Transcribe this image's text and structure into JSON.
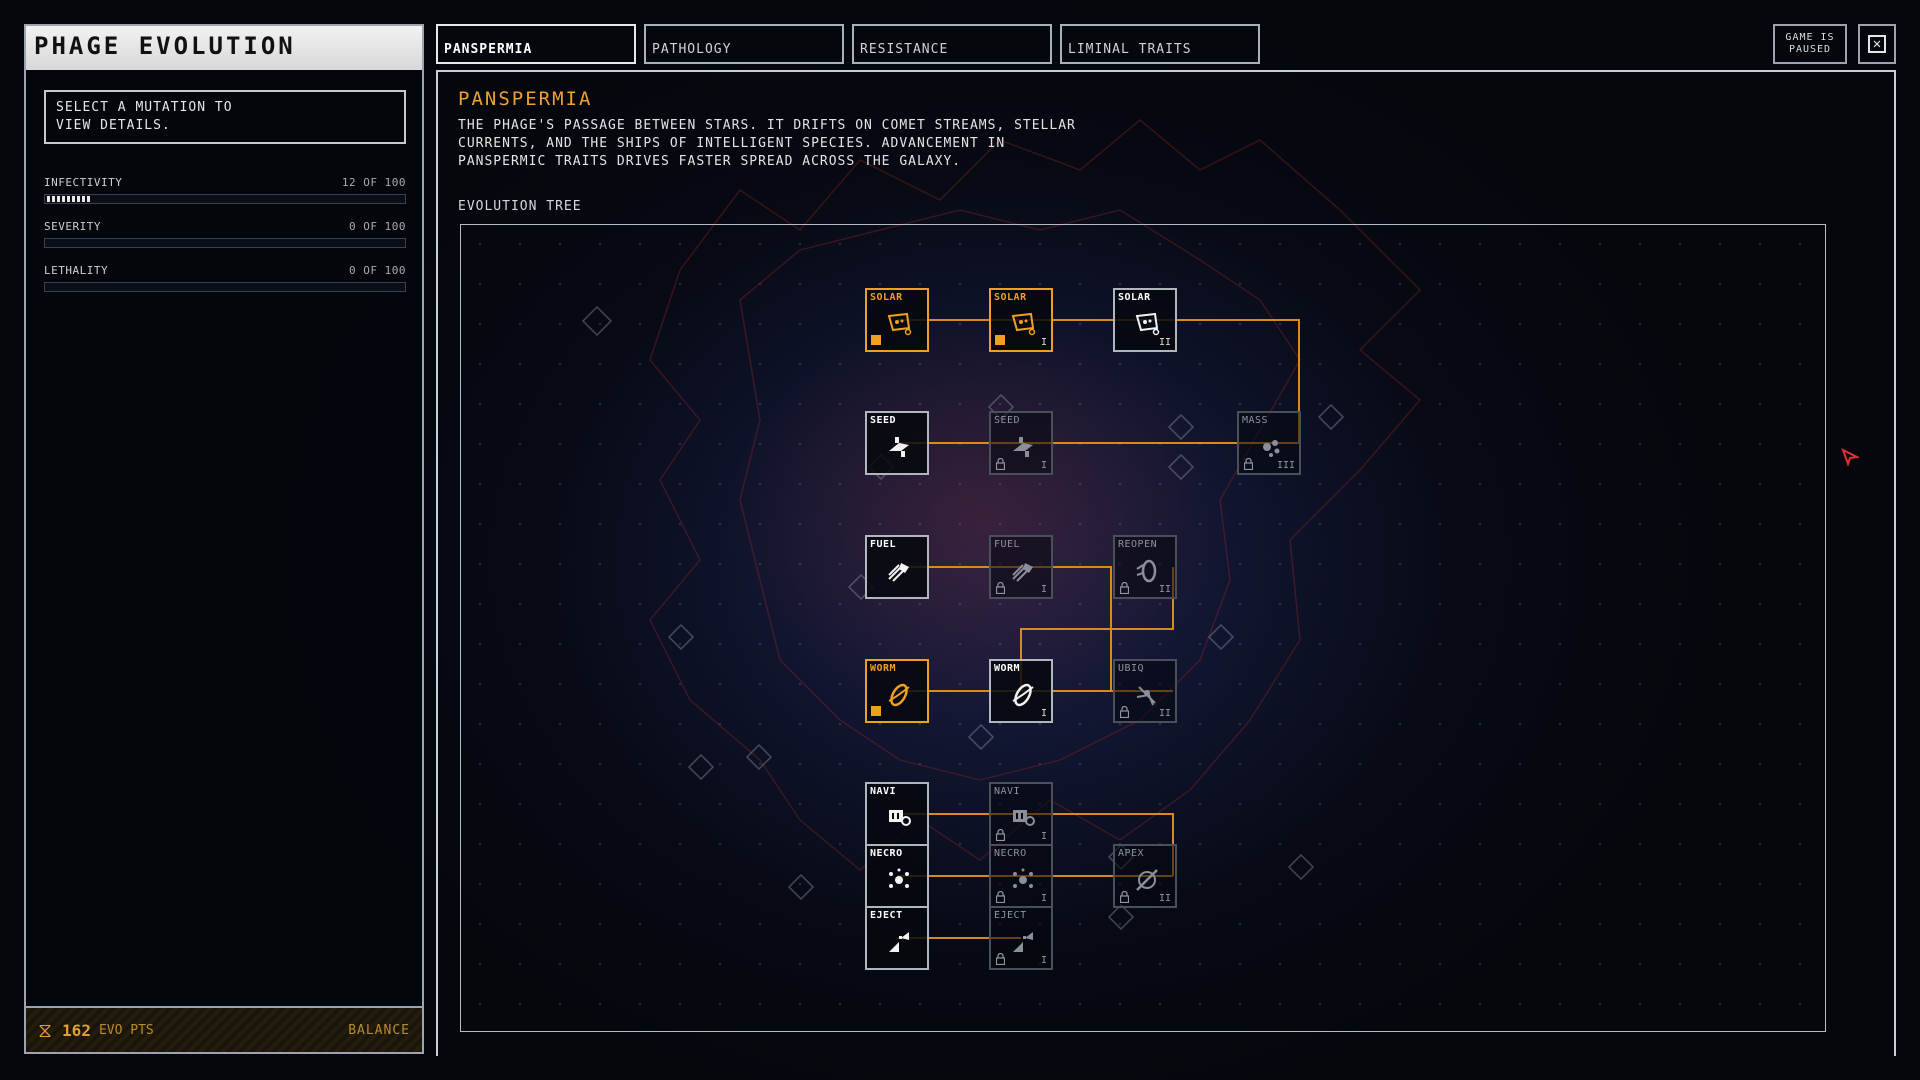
{
  "left_panel": {
    "title": "PHAGE EVOLUTION",
    "mutation_hint": "SELECT A MUTATION TO\nVIEW DETAILS.",
    "stats": [
      {
        "label": "INFECTIVITY",
        "value_text": "12 OF 100",
        "fraction": 0.12
      },
      {
        "label": "SEVERITY",
        "value_text": "0 OF 100",
        "fraction": 0.0
      },
      {
        "label": "LETHALITY",
        "value_text": "0 OF 100",
        "fraction": 0.0
      }
    ],
    "evo_points": "162",
    "evo_points_label": "EVO PTS",
    "balance_label": "BALANCE"
  },
  "tabs": [
    {
      "label": "PANSPERMIA",
      "active": true
    },
    {
      "label": "PATHOLOGY",
      "active": false
    },
    {
      "label": "RESISTANCE",
      "active": false
    },
    {
      "label": "LIMINAL TRAITS",
      "active": false
    }
  ],
  "status": {
    "paused_text": "GAME IS\nPAUSED"
  },
  "main": {
    "title": "PANSPERMIA",
    "description": "THE PHAGE'S PASSAGE BETWEEN STARS. IT DRIFTS ON COMET STREAMS, STELLAR CURRENTS, AND THE SHIPS OF INTELLIGENT SPECIES. ADVANCEMENT IN PANSPERMIC TRAITS DRIVES FASTER SPREAD ACROSS THE GALAXY.",
    "tree_label": "EVOLUTION TREE"
  },
  "tree_nodes": [
    {
      "id": "solar0",
      "label": "SOLAR",
      "tier": "",
      "state": "owned",
      "icon": "solar-sail-icon"
    },
    {
      "id": "solar1",
      "label": "SOLAR",
      "tier": "I",
      "state": "owned",
      "icon": "solar-sail-icon"
    },
    {
      "id": "solar2",
      "label": "SOLAR",
      "tier": "II",
      "state": "avail",
      "icon": "solar-sail-icon"
    },
    {
      "id": "seed0",
      "label": "SEED",
      "tier": "",
      "state": "avail",
      "icon": "seed-ship-icon"
    },
    {
      "id": "seed1",
      "label": "SEED",
      "tier": "I",
      "state": "locked",
      "icon": "seed-ship-icon"
    },
    {
      "id": "mass",
      "label": "MASS",
      "tier": "III",
      "state": "locked",
      "icon": "mass-cluster-icon"
    },
    {
      "id": "fuel0",
      "label": "FUEL",
      "tier": "",
      "state": "avail",
      "icon": "fuel-comet-icon"
    },
    {
      "id": "fuel1",
      "label": "FUEL",
      "tier": "I",
      "state": "locked",
      "icon": "fuel-comet-icon"
    },
    {
      "id": "reopen",
      "label": "REOPEN",
      "tier": "II",
      "state": "locked",
      "icon": "portal-icon"
    },
    {
      "id": "worm0",
      "label": "WORM",
      "tier": "",
      "state": "owned",
      "icon": "wormhole-icon"
    },
    {
      "id": "worm1",
      "label": "WORM",
      "tier": "I",
      "state": "avail",
      "icon": "wormhole-icon"
    },
    {
      "id": "ubiq",
      "label": "UBIQ",
      "tier": "II",
      "state": "locked",
      "icon": "ubiquity-icon"
    },
    {
      "id": "navi0",
      "label": "NAVI",
      "tier": "",
      "state": "avail",
      "icon": "navigation-icon"
    },
    {
      "id": "navi1",
      "label": "NAVI",
      "tier": "I",
      "state": "locked",
      "icon": "navigation-icon"
    },
    {
      "id": "necro0",
      "label": "NECRO",
      "tier": "",
      "state": "avail",
      "icon": "necro-spore-icon"
    },
    {
      "id": "necro1",
      "label": "NECRO",
      "tier": "I",
      "state": "locked",
      "icon": "necro-spore-icon"
    },
    {
      "id": "apex",
      "label": "APEX",
      "tier": "II",
      "state": "locked",
      "icon": "apex-icon"
    },
    {
      "id": "eject0",
      "label": "EJECT",
      "tier": "",
      "state": "avail",
      "icon": "eject-debris-icon"
    },
    {
      "id": "eject1",
      "label": "EJECT",
      "tier": "I",
      "state": "locked",
      "icon": "eject-debris-icon"
    }
  ],
  "colors": {
    "accent": "#f0a020",
    "panel_border": "#9ea4ad",
    "locked": "#4a4f5a"
  }
}
